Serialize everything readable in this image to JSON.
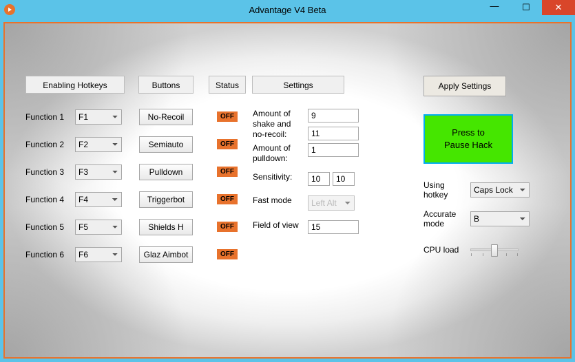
{
  "window": {
    "title": "Advantage V4 Beta"
  },
  "headers": {
    "hotkeys": "Enabling Hotkeys",
    "buttons": "Buttons",
    "status": "Status",
    "settings": "Settings"
  },
  "rows": [
    {
      "label": "Function 1",
      "key": "F1",
      "button": "No-Recoil",
      "status": "OFF"
    },
    {
      "label": "Function 2",
      "key": "F2",
      "button": "Semiauto",
      "status": "OFF"
    },
    {
      "label": "Function 3",
      "key": "F3",
      "button": "Pulldown",
      "status": "OFF"
    },
    {
      "label": "Function 4",
      "key": "F4",
      "button": "Triggerbot",
      "status": "OFF"
    },
    {
      "label": "Function 5",
      "key": "F5",
      "button": "Shields H",
      "status": "OFF"
    },
    {
      "label": "Function 6",
      "key": "F6",
      "button": "Glaz Aimbot",
      "status": "OFF"
    }
  ],
  "settings": {
    "shake_label": "Amount of shake and no-recoil:",
    "shake_val1": "9",
    "shake_val2": "11",
    "pulldown_label": "Amount of pulldown:",
    "pulldown_val": "1",
    "sensitivity_label": "Sensitivity:",
    "sens_a": "10",
    "sens_b": "10",
    "fastmode_label": "Fast mode",
    "fastmode_val": "Left Alt",
    "fov_label": "Field of view",
    "fov_val": "15"
  },
  "right": {
    "apply": "Apply Settings",
    "pause": "Press to\nPause Hack",
    "using_hotkey_label": "Using hotkey",
    "using_hotkey_val": "Caps Lock",
    "accurate_label": "Accurate mode",
    "accurate_val": "B",
    "cpu_label": "CPU load",
    "cpu_percent": 50
  },
  "colors": {
    "titlebar": "#5bc3e8",
    "border": "#e8722c",
    "status_badge": "#e8722c",
    "pause_bg": "#45e600",
    "pause_border": "#01adef",
    "close": "#d9462a"
  }
}
